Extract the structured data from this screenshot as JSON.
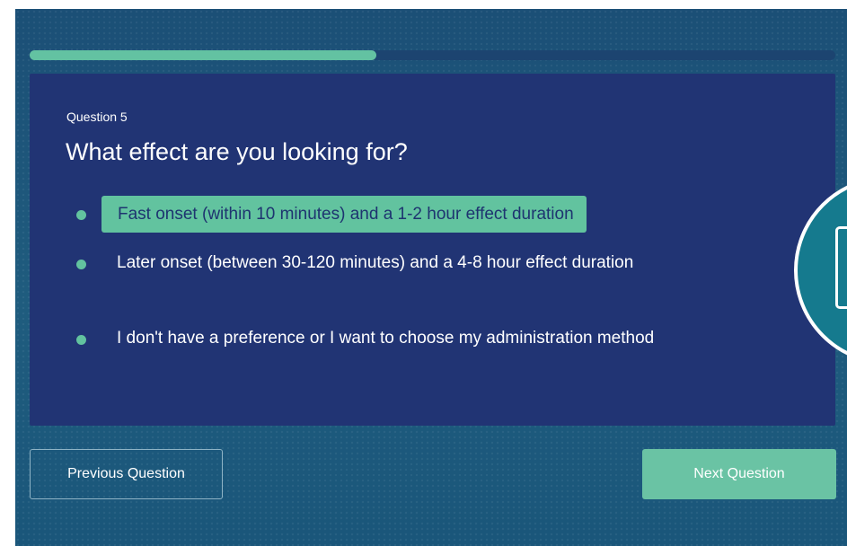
{
  "progress": {
    "fraction": 0.43
  },
  "question": {
    "number_label": "Question 5",
    "title": "What effect are you looking for?",
    "options": [
      {
        "label": "Fast onset (within 10 minutes) and a 1-2 hour effect duration",
        "selected": true
      },
      {
        "label": "Later onset (between 30-120 minutes) and a 4-8 hour effect duration",
        "selected": false
      },
      {
        "label": "I don't have a preference or I want to choose my administration method",
        "selected": false
      }
    ]
  },
  "nav": {
    "previous_label": "Previous Question",
    "next_label": "Next Question"
  },
  "colors": {
    "accent": "#62c39f",
    "card": "#213474",
    "background": "#1d577a",
    "badge": "#157a8e"
  },
  "icons": {
    "side_badge": "device-icon"
  }
}
